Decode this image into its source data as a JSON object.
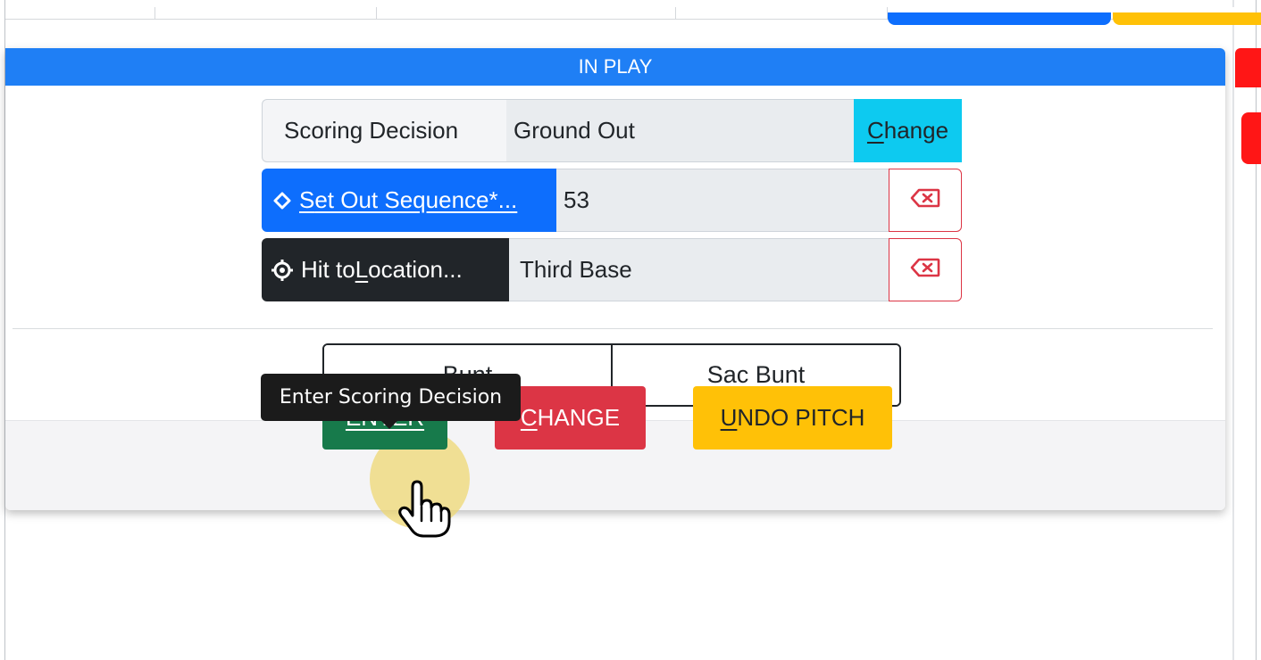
{
  "header": {
    "title": "IN PLAY"
  },
  "scoring": {
    "label": "Scoring Decision",
    "value": "Ground Out",
    "change_prefix": "C",
    "change_rest": "hange"
  },
  "out_sequence": {
    "label_prefix": "S",
    "label_rest": "et Out Sequence*...",
    "value": "53"
  },
  "hit_location": {
    "label_prefix": "Hit to ",
    "label_key": "L",
    "label_rest": "ocation...",
    "value": "Third Base"
  },
  "bunt": {
    "bunt_label": "Bunt",
    "sac_bunt_label": "Sac Bunt"
  },
  "footer": {
    "enter_label": "ENTER",
    "change_prefix": "C",
    "change_rest": "HANGE",
    "undo_prefix": "U",
    "undo_rest": "NDO PITCH"
  },
  "tooltip": {
    "text": "Enter Scoring Decision"
  },
  "colors": {
    "primary": "#0d6efd",
    "info": "#0dcaf0",
    "success": "#177a4b",
    "danger": "#dc3545",
    "warning": "#ffc107",
    "dark": "#212529"
  },
  "icons": {
    "set_sequence": "diamond-icon",
    "hit_location": "crosshair-icon",
    "delete": "backspace-icon",
    "pointer": "hand-pointer-icon"
  }
}
